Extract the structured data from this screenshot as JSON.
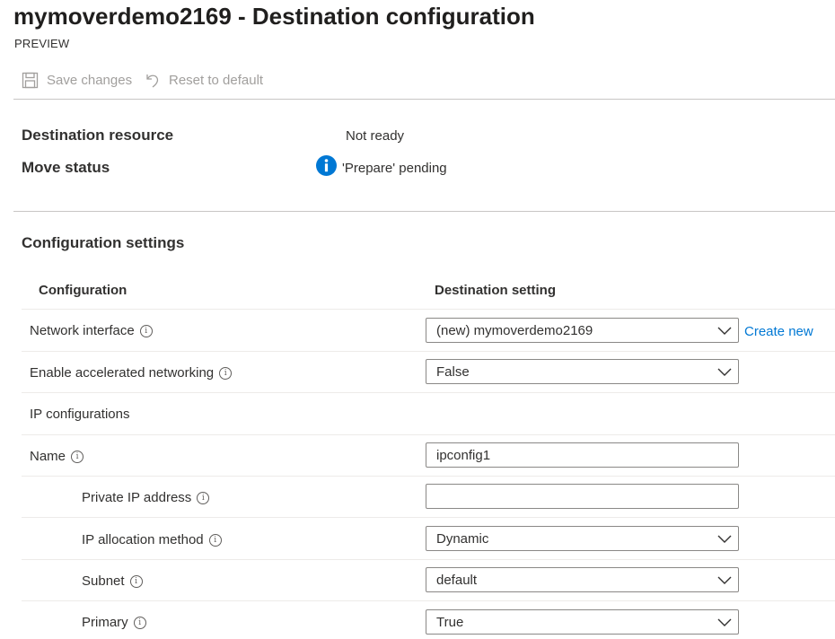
{
  "header": {
    "title": "mymoverdemo2169 - Destination configuration",
    "subtitle": "PREVIEW"
  },
  "toolbar": {
    "save_label": "Save changes",
    "reset_label": "Reset to default"
  },
  "summary": {
    "destination_resource_label": "Destination resource",
    "destination_resource_value": "Not ready",
    "move_status_label": "Move status",
    "move_status_value": "'Prepare' pending"
  },
  "config": {
    "section_title": "Configuration settings",
    "col_configuration": "Configuration",
    "col_destination": "Destination setting",
    "rows": [
      {
        "label": "Network interface",
        "value": "(new) mymoverdemo2169",
        "link": "Create new"
      },
      {
        "label": "Enable accelerated networking",
        "value": "False"
      },
      {
        "label": "IP configurations"
      },
      {
        "label": "Name",
        "value": "ipconfig1"
      },
      {
        "label": "Private IP address",
        "value": ""
      },
      {
        "label": "IP allocation method",
        "value": "Dynamic"
      },
      {
        "label": "Subnet",
        "value": "default"
      },
      {
        "label": "Primary",
        "value": "True"
      }
    ]
  },
  "colors": {
    "accent": "#0078d4",
    "disabled_text": "#a19f9d",
    "input_border": "#8a8886"
  }
}
